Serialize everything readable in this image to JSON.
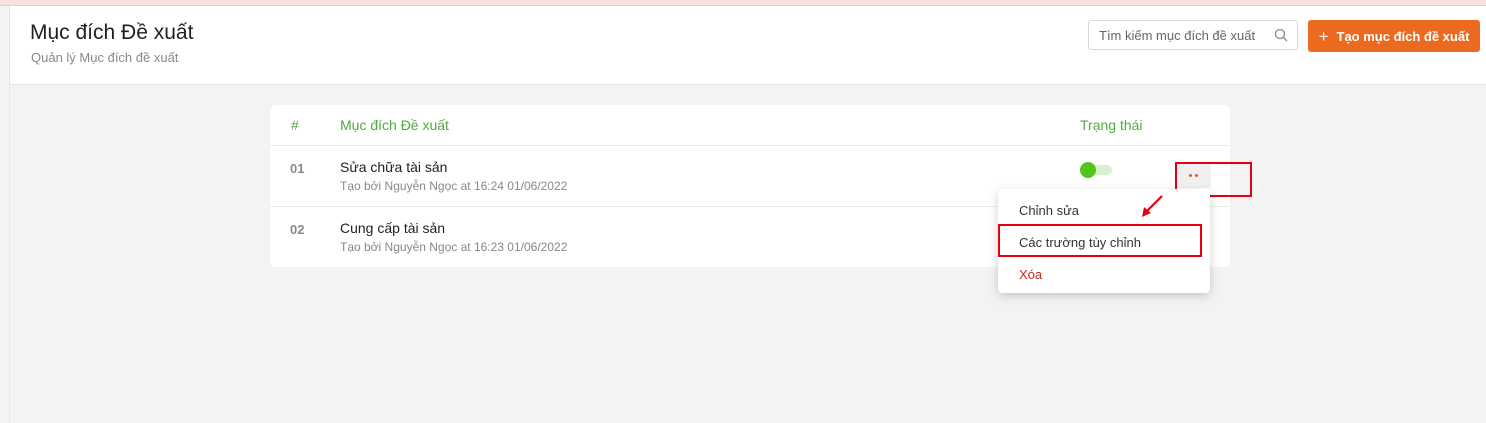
{
  "header": {
    "title": "Mục đích Đề xuất",
    "subtitle": "Quản lý Mục đích đề xuất",
    "search_placeholder": "Tìm kiếm mục đích đề xuất",
    "search_icon": "search-icon",
    "create_label": "Tạo mục đích đề xuất",
    "create_icon": "plus-icon",
    "accent_color": "#ec6a1f"
  },
  "table": {
    "columns": {
      "number": "#",
      "name": "Mục đích Đề xuất",
      "status": "Trạng thái"
    },
    "header_color": "#4cad3b",
    "rows": [
      {
        "number": "01",
        "title": "Sửa chữa tài sản",
        "meta": "Tạo bởi Nguyễn Ngọc at 16:24 01/06/2022",
        "status_on": true
      },
      {
        "number": "02",
        "title": "Cung cấp tài sản",
        "meta": "Tạo bởi Nguyễn Ngọc at 16:23 01/06/2022",
        "status_on": true
      }
    ]
  },
  "menu": {
    "items": [
      {
        "label": "Chỉnh sửa"
      },
      {
        "label": "Các trường tùy chỉnh"
      },
      {
        "label": "Xóa",
        "color": "#c9281f"
      }
    ]
  },
  "annotations": {
    "highlight_color": "#e3000f"
  }
}
